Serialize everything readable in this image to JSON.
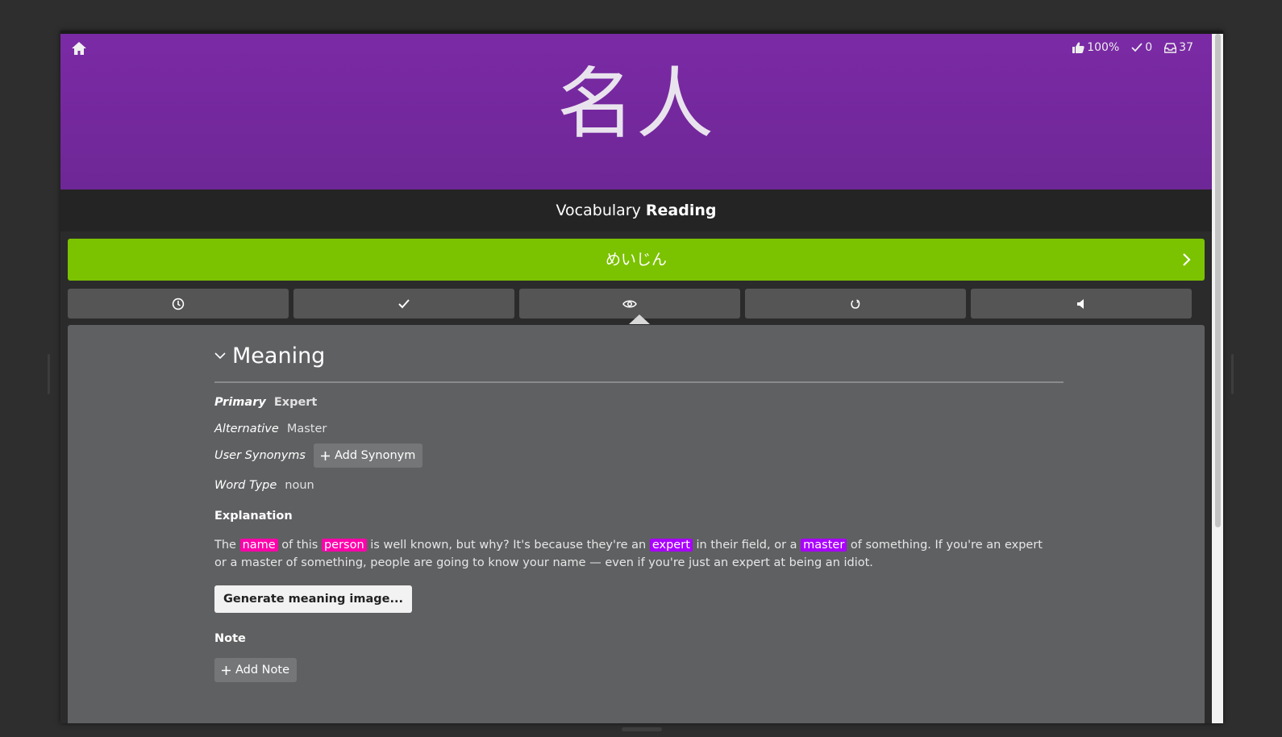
{
  "colors": {
    "header_purple": "#7b2aa5",
    "correct_green": "#7bc200",
    "highlight_vocab": "#a900ff",
    "highlight_radical": "#ff00aa"
  },
  "header": {
    "home_icon": "home-icon",
    "stats": {
      "accuracy": "100%",
      "completed": "0",
      "remaining": "37"
    },
    "subject": "名人"
  },
  "question_type": {
    "category": "Vocabulary",
    "type": "Reading"
  },
  "answer": {
    "text": "めいじん",
    "state": "correct"
  },
  "toolbar": {
    "buttons": [
      {
        "icon": "clock-icon"
      },
      {
        "icon": "check-icon"
      },
      {
        "icon": "eye-icon"
      },
      {
        "icon": "undo-icon"
      },
      {
        "icon": "speaker-icon"
      }
    ],
    "active_index": 2
  },
  "meaning": {
    "section_title": "Meaning",
    "primary_label": "Primary",
    "primary_value": "Expert",
    "alternative_label": "Alternative",
    "alternative_value": "Master",
    "user_synonyms_label": "User Synonyms",
    "add_synonym_label": "Add Synonym",
    "word_type_label": "Word Type",
    "word_type_value": "noun",
    "explanation_heading": "Explanation",
    "explanation": {
      "t1": "The ",
      "h1": "name",
      "t2": " of this ",
      "h2": "person",
      "t3": " is well known, but why? It's because they're an ",
      "h3": "expert",
      "t4": " in their field, or a ",
      "h4": "master",
      "t5": " of something. If you're an expert or a master of something, people are going to know your name — even if you're just an expert at being an idiot."
    },
    "generate_image_label": "Generate meaning image...",
    "note_heading": "Note",
    "add_note_label": "Add Note"
  }
}
